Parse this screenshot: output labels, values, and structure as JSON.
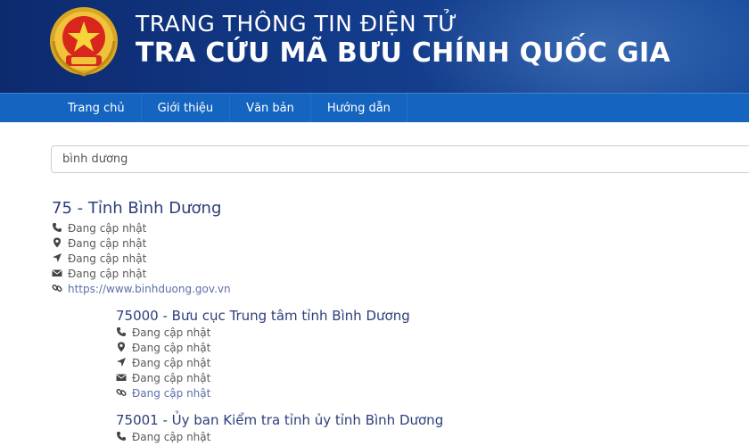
{
  "header": {
    "title_line1": "TRANG THÔNG TIN ĐIỆN TỬ",
    "title_line2": "TRA CỨU MÃ BƯU CHÍNH QUỐC GIA"
  },
  "nav": {
    "items": [
      "Trang chủ",
      "Giới thiệu",
      "Văn bản",
      "Hướng dẫn"
    ]
  },
  "search": {
    "value": "bình dương"
  },
  "province": {
    "title": "75 - Tỉnh Bình Dương",
    "phone": "Đang cập nhật",
    "address": "Đang cập nhật",
    "location": "Đang cập nhật",
    "email": "Đang cập nhật",
    "website": "https://www.binhduong.gov.vn"
  },
  "offices": [
    {
      "title": "75000 - Bưu cục Trung tâm tỉnh Bình Dương",
      "phone": "Đang cập nhật",
      "address": "Đang cập nhật",
      "location": "Đang cập nhật",
      "email": "Đang cập nhật",
      "website": "Đang cập nhật"
    },
    {
      "title": "75001 - Ủy ban Kiểm tra tỉnh ủy tỉnh Bình Dương",
      "phone": "Đang cập nhật"
    }
  ],
  "colors": {
    "header_bg": "#123a88",
    "nav_bg": "#1565c0",
    "title_text": "#2c3e7a"
  },
  "icons": {
    "phone": "phone-icon",
    "address": "map-marker-icon",
    "location": "location-arrow-icon",
    "email": "envelope-icon",
    "website": "link-icon"
  }
}
